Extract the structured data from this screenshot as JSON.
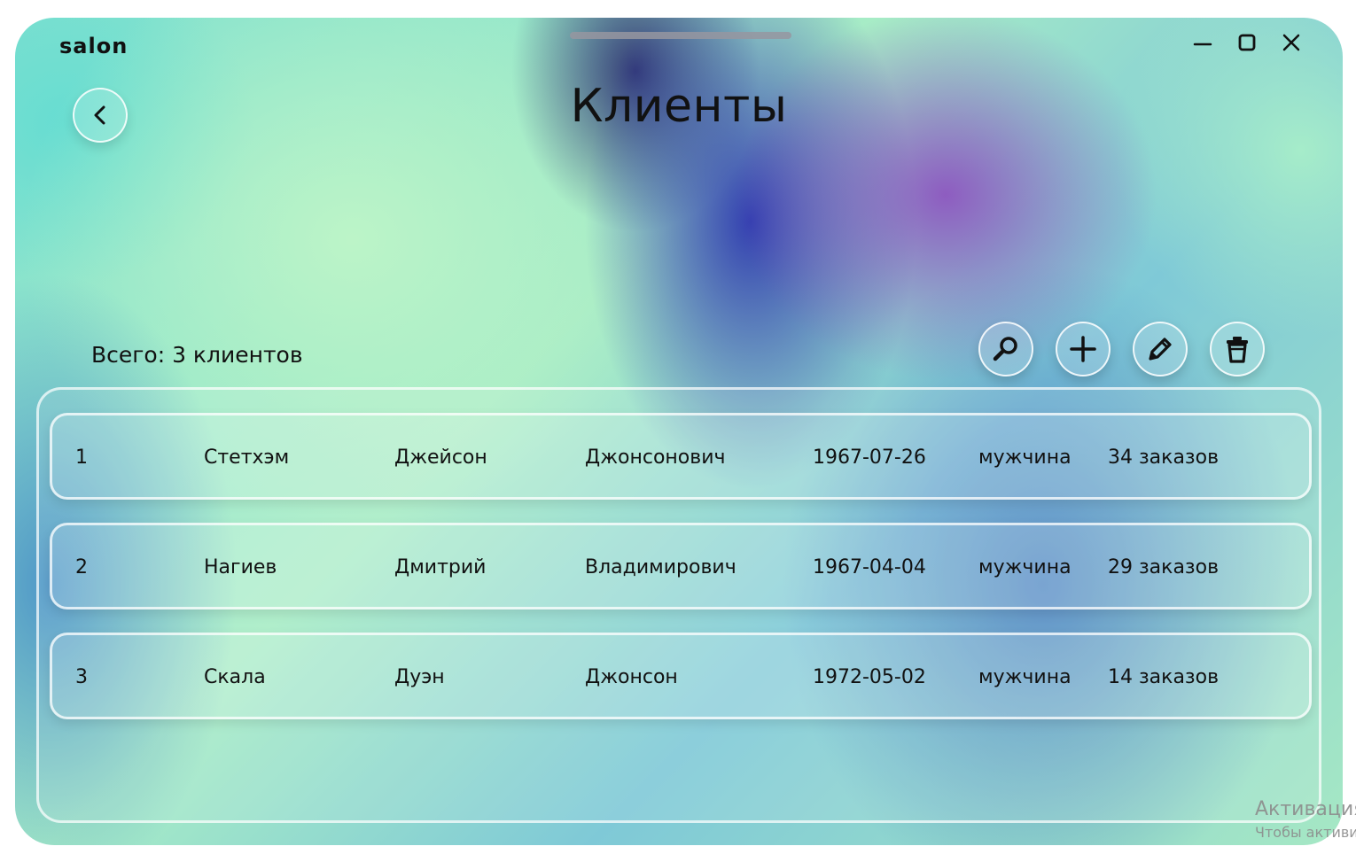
{
  "app": {
    "logo": "salon"
  },
  "window_controls": {
    "minimize_icon": "minimize-icon",
    "maximize_icon": "maximize-icon",
    "close_icon": "close-icon"
  },
  "header": {
    "title": "Клиенты",
    "back_icon": "chevron-left-icon"
  },
  "summary": {
    "total": "Всего: 3 клиентов"
  },
  "toolbar": {
    "search_icon": "search-icon",
    "add_icon": "plus-icon",
    "edit_icon": "pencil-icon",
    "delete_icon": "trash-icon"
  },
  "clients": [
    {
      "id": "1",
      "last_name": "Стетхэм",
      "first_name": "Джейсон",
      "patronymic": "Джонсонович",
      "birth_date": "1967-07-26",
      "gender": "мужчина",
      "orders": "34 заказов"
    },
    {
      "id": "2",
      "last_name": "Нагиев",
      "first_name": "Дмитрий",
      "patronymic": "Владимирович",
      "birth_date": "1967-04-04",
      "gender": "мужчина",
      "orders": "29 заказов"
    },
    {
      "id": "3",
      "last_name": "Скала",
      "first_name": "Дуэн",
      "patronymic": "Джонсон",
      "birth_date": "1972-05-02",
      "gender": "мужчина",
      "orders": "14 заказов"
    }
  ],
  "os_watermark": {
    "line1": "Активация",
    "line2": "Чтобы активи"
  }
}
